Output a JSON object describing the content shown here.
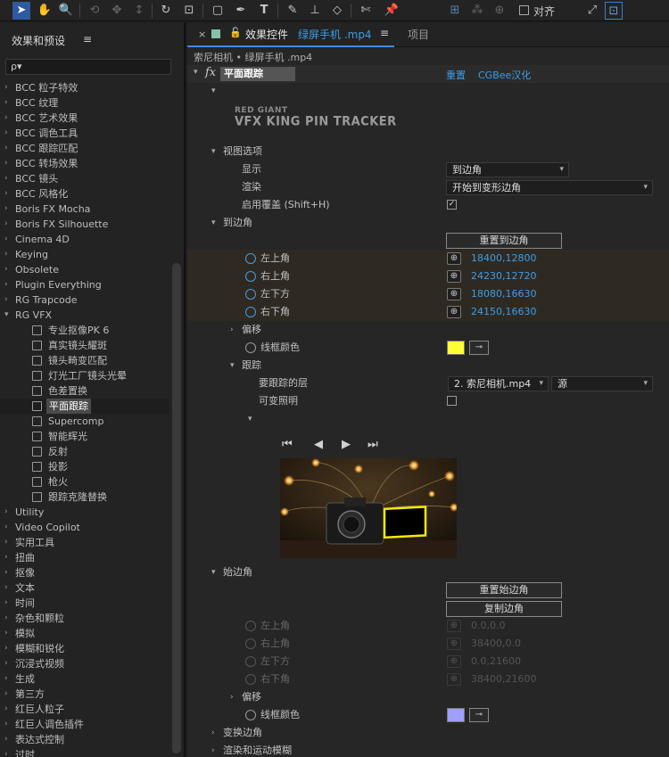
{
  "toolbar": {
    "icons": [
      "selection-tool",
      "hand-tool",
      "zoom-tool",
      "rotate-camera",
      "move-camera",
      "pan-camera",
      "rotate-tool",
      "anchor-tool",
      "rectangle-tool",
      "pen-tool",
      "type-tool",
      "brush-tool",
      "stamp-tool",
      "eraser-tool",
      "roto-tool",
      "puppet-tool"
    ],
    "align_label": "对齐"
  },
  "left_panel": {
    "title": "效果和预设",
    "menu": "≡",
    "search_placeholder": "ρ▾",
    "items": [
      {
        "label": "BCC 粒子特效",
        "type": "folder"
      },
      {
        "label": "BCC 纹理",
        "type": "folder"
      },
      {
        "label": "BCC 艺术效果",
        "type": "folder"
      },
      {
        "label": "BCC 调色工具",
        "type": "folder"
      },
      {
        "label": "BCC 跟踪匹配",
        "type": "folder"
      },
      {
        "label": "BCC 转场效果",
        "type": "folder"
      },
      {
        "label": "BCC 镜头",
        "type": "folder"
      },
      {
        "label": "BCC 风格化",
        "type": "folder"
      },
      {
        "label": "Boris FX Mocha",
        "type": "folder"
      },
      {
        "label": "Boris FX Silhouette",
        "type": "folder"
      },
      {
        "label": "Cinema 4D",
        "type": "folder"
      },
      {
        "label": "Keying",
        "type": "folder"
      },
      {
        "label": "Obsolete",
        "type": "folder"
      },
      {
        "label": "Plugin Everything",
        "type": "folder"
      },
      {
        "label": "RG Trapcode",
        "type": "folder"
      },
      {
        "label": "RG VFX",
        "type": "open"
      },
      {
        "label": "专业抠像PK 6",
        "type": "child"
      },
      {
        "label": "真实镜头耀斑",
        "type": "child"
      },
      {
        "label": "镜头畸变匹配",
        "type": "child"
      },
      {
        "label": "灯光工厂镜头光晕",
        "type": "child"
      },
      {
        "label": "色差置换",
        "type": "child"
      },
      {
        "label": "平面跟踪",
        "type": "child-selected"
      },
      {
        "label": "Supercomp",
        "type": "child"
      },
      {
        "label": "智能辉光",
        "type": "child"
      },
      {
        "label": "反射",
        "type": "child"
      },
      {
        "label": "投影",
        "type": "child"
      },
      {
        "label": "枪火",
        "type": "child"
      },
      {
        "label": "跟踪克隆替换",
        "type": "child"
      },
      {
        "label": "Utility",
        "type": "folder"
      },
      {
        "label": "Video Copilot",
        "type": "folder"
      },
      {
        "label": "实用工具",
        "type": "folder"
      },
      {
        "label": "扭曲",
        "type": "folder"
      },
      {
        "label": "抠像",
        "type": "folder"
      },
      {
        "label": "文本",
        "type": "folder"
      },
      {
        "label": "时间",
        "type": "folder"
      },
      {
        "label": "杂色和颗粒",
        "type": "folder"
      },
      {
        "label": "模拟",
        "type": "folder"
      },
      {
        "label": "模糊和锐化",
        "type": "folder"
      },
      {
        "label": "沉浸式视频",
        "type": "folder"
      },
      {
        "label": "生成",
        "type": "folder"
      },
      {
        "label": "第三方",
        "type": "folder"
      },
      {
        "label": "红巨人粒子",
        "type": "folder"
      },
      {
        "label": "红巨人调色插件",
        "type": "folder"
      },
      {
        "label": "表达式控制",
        "type": "folder"
      },
      {
        "label": "过时",
        "type": "folder"
      }
    ]
  },
  "effect_controls": {
    "tab_close": "×",
    "tab_title": "效果控件",
    "tab_file": "绿屏手机 .mp4",
    "tab_menu": "≡",
    "tab2": "项目",
    "breadcrumb": "索尼相机 • 绿屏手机 .mp4",
    "fx_label": "fx",
    "effect_name": "平面跟踪",
    "reset_label": "重置",
    "cgbee_label": "CGBee汉化",
    "logo_small": "RED GIANT",
    "logo_large": "VFX KING PIN TRACKER",
    "view_options": "视图选项",
    "display_label": "显示",
    "display_value": "到边角",
    "render_label": "渲染",
    "render_value": "开始到变形边角",
    "overlay_label": "启用覆盖 (Shift+H)",
    "to_corners": "到边角",
    "reset_to_corners": "重置到边角",
    "top_left": "左上角",
    "top_left_val": "18400,12800",
    "top_right": "右上角",
    "top_right_val": "24230,12720",
    "bottom_left": "左下方",
    "bottom_left_val": "18080,16630",
    "bottom_right": "右下角",
    "bottom_right_val": "24150,16630",
    "offset": "偏移",
    "wire_color": "线框颜色",
    "wire_color_hex": "#ffff33",
    "tracking": "跟踪",
    "track_layer": "要跟踪的层",
    "track_layer_value": "2. 索尼相机.mp4",
    "source_value": "源",
    "variable_light": "可变照明",
    "player_buttons": [
      "⏮",
      "◀",
      "▶",
      "⏭"
    ],
    "start_corners": "始边角",
    "reset_start_corners": "重置始边角",
    "copy_corners": "复制边角",
    "s_top_left": "左上角",
    "s_top_left_val": "0.0,0.0",
    "s_top_right": "右上角",
    "s_top_right_val": "38400,0.0",
    "s_bottom_left": "左下方",
    "s_bottom_left_val": "0.0,21600",
    "s_bottom_right": "右下角",
    "s_bottom_right_val": "38400,21600",
    "offset2": "偏移",
    "wire_color2": "线框颜色",
    "wire_color2_hex": "#9f9fff",
    "transform_corners": "变换边角",
    "render_motion_blur": "渲染和运动模糊"
  }
}
